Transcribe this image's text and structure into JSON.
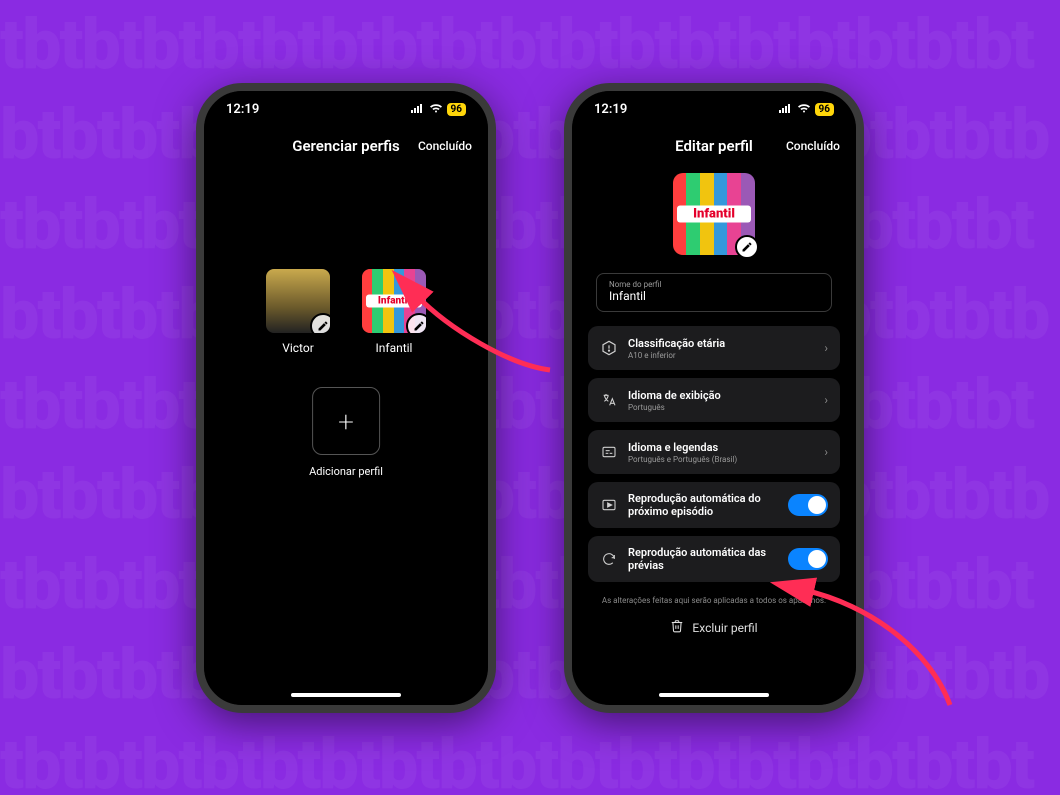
{
  "status": {
    "time": "12:19",
    "battery": "96"
  },
  "screen1": {
    "title": "Gerenciar perfis",
    "done": "Concluído",
    "profiles": [
      {
        "name": "Victor"
      },
      {
        "name": "Infantil",
        "tag": "Infantil"
      }
    ],
    "add_label": "Adicionar perfil",
    "add_glyph": "+"
  },
  "screen2": {
    "title": "Editar perfil",
    "done": "Concluído",
    "avatar_tag": "Infantil",
    "name_field": {
      "label": "Nome do perfil",
      "value": "Infantil"
    },
    "rows": {
      "rating": {
        "title": "Classificação etária",
        "sub": "A10 e inferior"
      },
      "display": {
        "title": "Idioma de exibição",
        "sub": "Português"
      },
      "subs": {
        "title": "Idioma e legendas",
        "sub": "Português e Português (Brasil)"
      },
      "autoplay_next": {
        "title": "Reprodução automática do próximo episódio"
      },
      "autoplay_preview": {
        "title": "Reprodução automática das prévias"
      }
    },
    "footnote": "As alterações feitas aqui serão aplicadas a todos os aparelhos.",
    "delete": "Excluir perfil"
  },
  "chevron": "›"
}
